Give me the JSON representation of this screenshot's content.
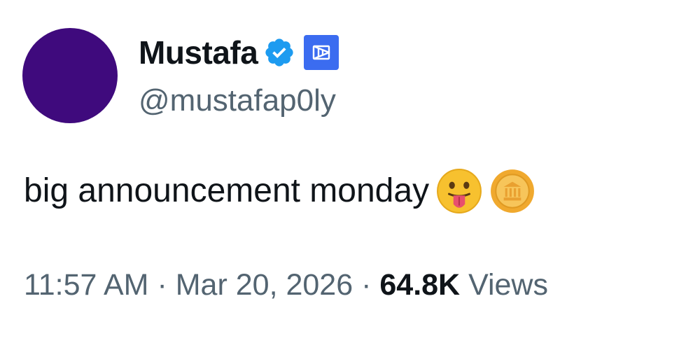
{
  "user": {
    "display_name": "Mustafa",
    "handle": "@mustafap0ly",
    "avatar_color": "#3f0a7d",
    "verified_icon": "verified-badge-icon",
    "affiliate_icon": "affiliate-logo-icon"
  },
  "tweet": {
    "text": "big announcement monday",
    "emojis": [
      "tongue-out-face-icon",
      "coin-icon"
    ]
  },
  "meta": {
    "time": "11:57 AM",
    "separator": "·",
    "date": "Mar 20, 2026",
    "views_count": "64.8K",
    "views_label": "Views"
  },
  "colors": {
    "text_primary": "#0f1419",
    "text_secondary": "#536471",
    "verified_blue": "#1d9bf0",
    "affiliate_blue": "#3b6cf0"
  }
}
